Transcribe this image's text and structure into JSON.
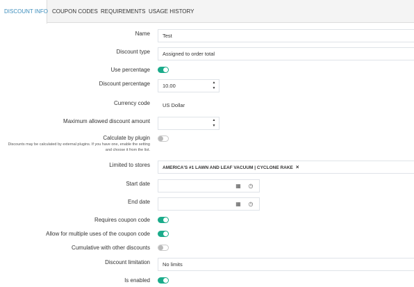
{
  "tabs": [
    {
      "label": "Discount info",
      "active": true
    },
    {
      "label": "Coupon codes",
      "active": false
    },
    {
      "label": "Requirements",
      "active": false
    },
    {
      "label": "Usage history",
      "active": false
    }
  ],
  "form": {
    "name": {
      "label": "Name",
      "value": "Test"
    },
    "discount_type": {
      "label": "Discount type",
      "value": "Assigned to order total"
    },
    "use_percentage": {
      "label": "Use percentage",
      "checked": true
    },
    "discount_percentage": {
      "label": "Discount percentage",
      "value": "10.00"
    },
    "currency_code": {
      "label": "Currency code",
      "value": "US Dollar"
    },
    "max_discount_amount": {
      "label": "Maximum allowed discount amount",
      "value": ""
    },
    "calculate_by_plugin": {
      "label": "Calculate by plugin",
      "hint": "Discounts may be calculated by external plugins. If you have one, enable the setting and choose it from the list.",
      "checked": false
    },
    "limited_to_stores": {
      "label": "Limited to stores",
      "tag": "AMERICA'S #1 LAWN AND LEAF VACUUM | CYCLONE RAKE",
      "remove": "×"
    },
    "start_date": {
      "label": "Start date",
      "value": ""
    },
    "end_date": {
      "label": "End date",
      "value": ""
    },
    "requires_coupon_code": {
      "label": "Requires coupon code",
      "checked": true
    },
    "multiple_uses": {
      "label": "Allow for multiple uses of the coupon code",
      "checked": true
    },
    "cumulative": {
      "label": "Cumulative with other discounts",
      "checked": false
    },
    "discount_limitation": {
      "label": "Discount limitation",
      "value": "No limits"
    },
    "is_enabled": {
      "label": "Is enabled",
      "checked": true
    }
  },
  "icons": {
    "spin_up": "▲",
    "spin_down": "▼",
    "calendar": "▦",
    "clock": "◷"
  },
  "colors": {
    "accent": "#3c8dbc",
    "toggle_on": "#1aab8a",
    "tabs_bg": "#f4f4f4",
    "border": "#dfe3e8"
  }
}
